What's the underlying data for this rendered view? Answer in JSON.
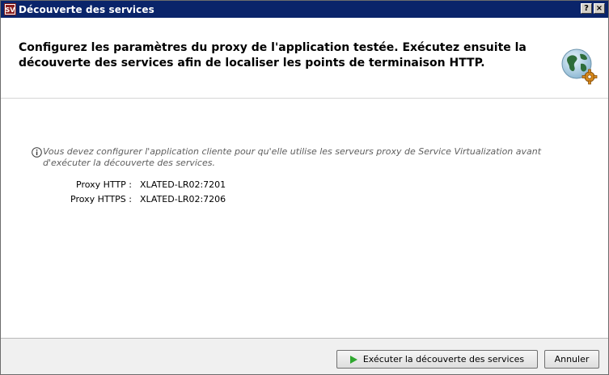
{
  "window": {
    "title": "Découverte des services",
    "help_label": "?",
    "close_label": "×"
  },
  "header": {
    "instruction": "Configurez les paramètres du proxy de l'application testée. Exécutez ensuite la découverte des services afin de localiser les points de terminaison HTTP."
  },
  "content": {
    "info_message": "Vous devez configurer l'application cliente pour qu'elle utilise les serveurs proxy de Service Virtualization avant d'exécuter la découverte des services.",
    "proxies": [
      {
        "label": "Proxy HTTP :",
        "value": "XLATED-LR02:7201"
      },
      {
        "label": "Proxy HTTPS :",
        "value": "XLATED-LR02:7206"
      }
    ]
  },
  "footer": {
    "run_button": "Exécuter la découverte des services",
    "cancel_button": "Annuler"
  },
  "colors": {
    "titlebar": "#0a246a",
    "play_icon": "#2fa82f",
    "info_text": "#5e5e5e"
  }
}
